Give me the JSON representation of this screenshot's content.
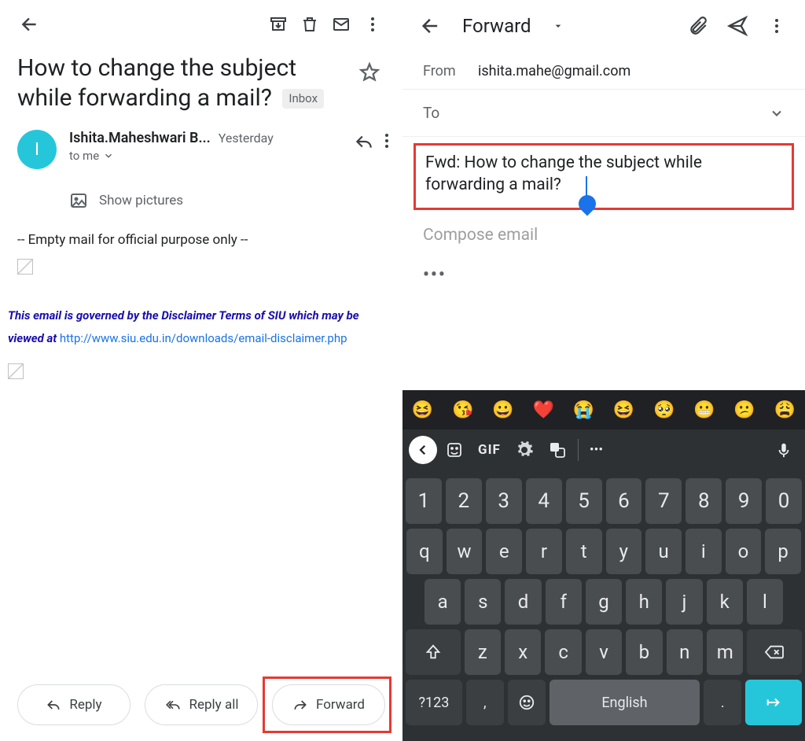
{
  "left": {
    "subject": "How to change the subject while forwarding a mail?",
    "inbox_chip": "Inbox",
    "sender_name": "Ishita.Maheshwari B...",
    "sender_initial": "I",
    "sender_time": "Yesterday",
    "to_line": "to me",
    "show_pictures": "Show pictures",
    "body_line": "-- Empty mail for official purpose only --",
    "disclaimer_prefix": "This email is governed by the Disclaimer Terms of  SIU which may be viewed at ",
    "disclaimer_link": "http://www.siu.edu.in/downloads/email-disclaimer.php",
    "reply_label": "Reply",
    "reply_all_label": "Reply all",
    "forward_label": "Forward"
  },
  "right": {
    "title": "Forward",
    "from_label": "From",
    "from_value": "ishita.mahe@gmail.com",
    "to_label": "To",
    "subject_value": "Fwd: How to change the subject while forwarding a mail?",
    "compose_placeholder": "Compose email",
    "quoted_dots": "•••"
  },
  "keyboard": {
    "emojis": [
      "😆",
      "😘",
      "😀",
      "❤️",
      "😭",
      "😆",
      "🥺",
      "😬",
      "😕",
      "😩"
    ],
    "gif_label": "GIF",
    "dots": "•••",
    "row1": [
      "1",
      "2",
      "3",
      "4",
      "5",
      "6",
      "7",
      "8",
      "9",
      "0"
    ],
    "row2": [
      "q",
      "w",
      "e",
      "r",
      "t",
      "y",
      "u",
      "i",
      "o",
      "p"
    ],
    "row3": [
      "a",
      "s",
      "d",
      "f",
      "g",
      "h",
      "j",
      "k",
      "l"
    ],
    "row4": [
      "z",
      "x",
      "c",
      "v",
      "b",
      "n",
      "m"
    ],
    "numlock": "?123",
    "comma": ",",
    "space": "English",
    "period": "."
  }
}
